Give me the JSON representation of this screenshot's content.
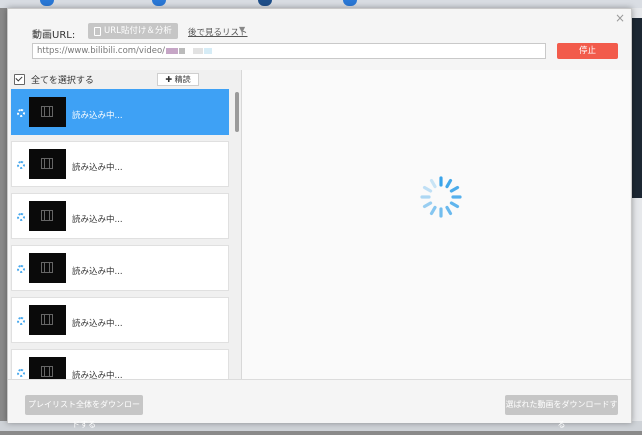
{
  "dialog": {
    "close_glyph": "×",
    "url_label": "動画URL:",
    "paste_button": "URL貼付け＆分析",
    "watch_later": "後で見るリスト",
    "watch_later_arrow": "▼",
    "url_value": "https://www.bilibili.com/video/",
    "stop_button": "停止",
    "stop_color": "#f25b4b",
    "select_all": "全てを選択する",
    "fine_button": "✚ 精読",
    "items": [
      {
        "label": "読み込み中..."
      },
      {
        "label": "読み込み中..."
      },
      {
        "label": "読み込み中..."
      },
      {
        "label": "読み込み中..."
      },
      {
        "label": "読み込み中..."
      },
      {
        "label": "読み込み中..."
      }
    ],
    "selected_color": "#3ea1f5",
    "download_all_button": "プレイリスト全体をダウンロードする",
    "download_selected_button": "選ばれた動画をダウンロードする"
  }
}
